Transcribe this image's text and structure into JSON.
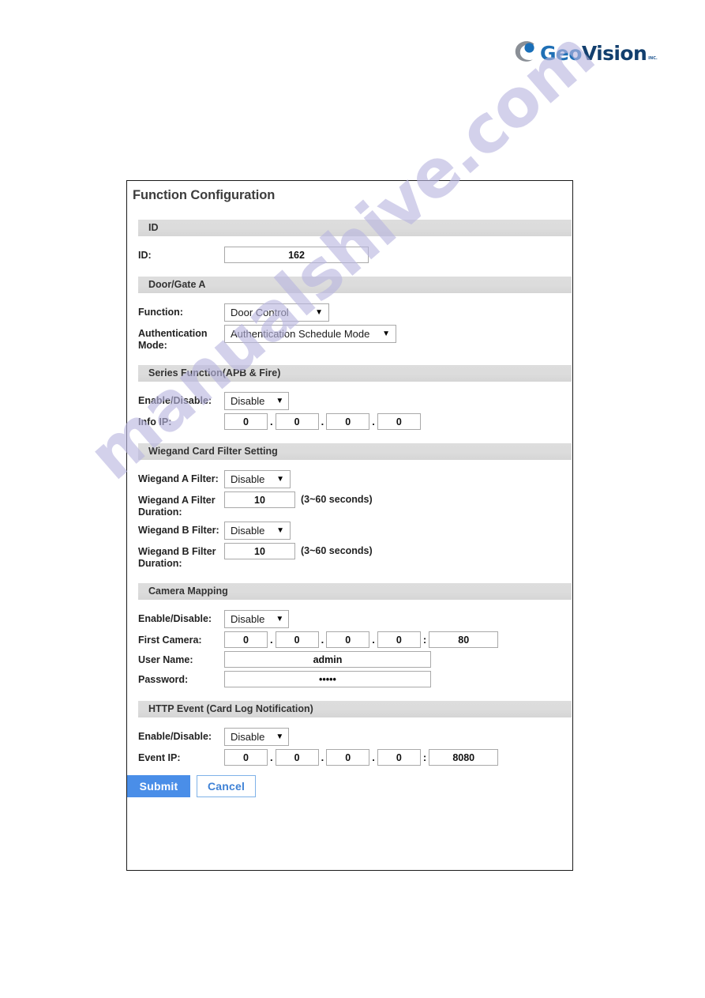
{
  "brand": {
    "name_part1": "Geo",
    "name_part2": "Vision",
    "tagline": "INC.",
    "logo_icon": "geovision-swoosh-logo",
    "color_primary": "#1f6fb5",
    "color_secondary": "#123f6e"
  },
  "watermark": {
    "text": "manualshive.com",
    "color": "#b9b6e0"
  },
  "panel": {
    "title": "Function Configuration",
    "sections": [
      {
        "heading": "ID",
        "rows": [
          {
            "label": "ID:",
            "value": "162"
          }
        ]
      },
      {
        "heading": "Door/Gate A",
        "rows": [
          {
            "label": "Function:",
            "value": "Door Control"
          },
          {
            "label": "Authentication Mode:",
            "value": "Authentication Schedule Mode"
          }
        ]
      },
      {
        "heading": "Series Function(APB & Fire)",
        "rows": [
          {
            "label": "Enable/Disable:",
            "value": "Disable"
          },
          {
            "label": "Info IP:",
            "octets": [
              "0",
              "0",
              "0",
              "0"
            ]
          }
        ]
      },
      {
        "heading": "Wiegand Card Filter Setting",
        "rows": [
          {
            "label": "Wiegand A Filter:",
            "value": "Disable"
          },
          {
            "label": "Wiegand A Filter Duration:",
            "value": "10",
            "hint": "(3~60 seconds)"
          },
          {
            "label": "Wiegand B Filter:",
            "value": "Disable"
          },
          {
            "label": "Wiegand B Filter Duration:",
            "value": "10",
            "hint": "(3~60 seconds)"
          }
        ]
      },
      {
        "heading": "Camera Mapping",
        "rows": [
          {
            "label": "Enable/Disable:",
            "value": "Disable"
          },
          {
            "label": "First Camera:",
            "octets": [
              "0",
              "0",
              "0",
              "0"
            ],
            "port": "80"
          },
          {
            "label": "User Name:",
            "value": "admin"
          },
          {
            "label": "Password:",
            "value": "•••••"
          }
        ]
      },
      {
        "heading": "HTTP Event (Card Log Notification)",
        "rows": [
          {
            "label": "Enable/Disable:",
            "value": "Disable"
          },
          {
            "label": "Event IP:",
            "octets": [
              "0",
              "0",
              "0",
              "0"
            ],
            "port": "8080"
          }
        ]
      }
    ],
    "buttons": {
      "submit": "Submit",
      "cancel": "Cancel"
    },
    "separators": {
      "dot": ".",
      "colon": ":"
    },
    "caret": "▼"
  }
}
